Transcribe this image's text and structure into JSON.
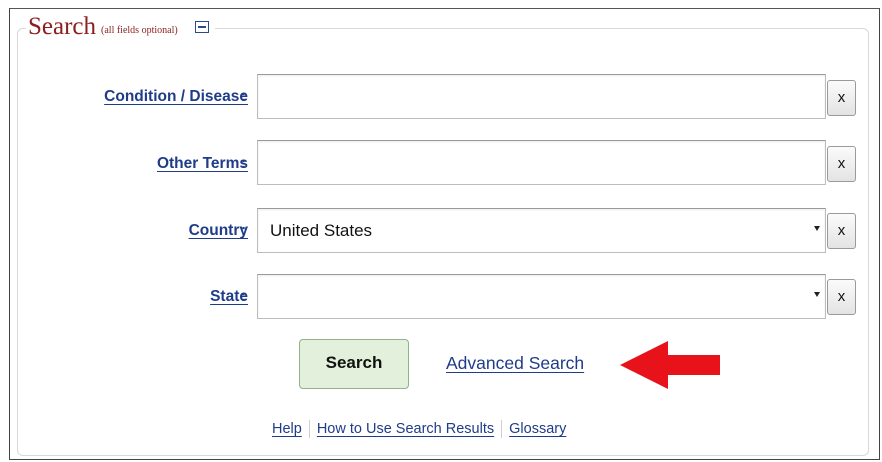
{
  "legend": {
    "title": "Search",
    "note": "(all fields optional)"
  },
  "fields": [
    {
      "label": "Condition / Disease",
      "value": ""
    },
    {
      "label": "Other Terms",
      "value": ""
    },
    {
      "label": "Country",
      "value": "United States"
    },
    {
      "label": "State",
      "value": ""
    }
  ],
  "colon": ":",
  "clear_label": "x",
  "buttons": {
    "search": "Search",
    "advanced": "Advanced Search"
  },
  "footer": [
    "Help",
    "How to Use Search Results",
    "Glossary"
  ],
  "accent": {
    "arrow": "#e8121b",
    "link": "#1f3c88",
    "title": "#8b1e1e",
    "search_bg": "#e3f0dc"
  }
}
